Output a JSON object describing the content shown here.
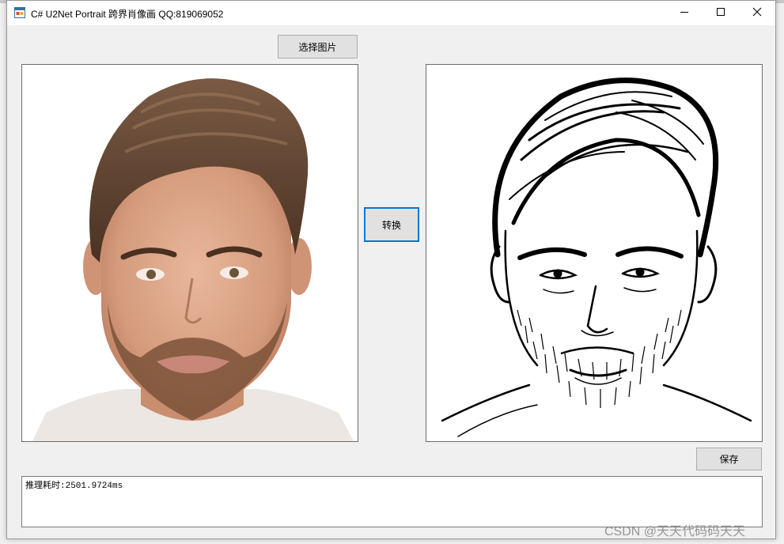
{
  "window": {
    "title": "C# U2Net Portrait 跨界肖像画 QQ:819069052",
    "icon": "winforms-app-icon",
    "controls": [
      "minimize-icon",
      "maximize-icon",
      "close-icon"
    ]
  },
  "buttons": {
    "select_image": "选择图片",
    "convert": "转换",
    "save": "保存"
  },
  "images": {
    "input": "photo-portrait",
    "output": "sketch-portrait"
  },
  "log": {
    "text": "推理耗时:2501.9724ms"
  },
  "watermark": "CSDN @天天代码码天天",
  "colors": {
    "focus_border": "#0078d7",
    "window_bg": "#f0f0f0"
  }
}
